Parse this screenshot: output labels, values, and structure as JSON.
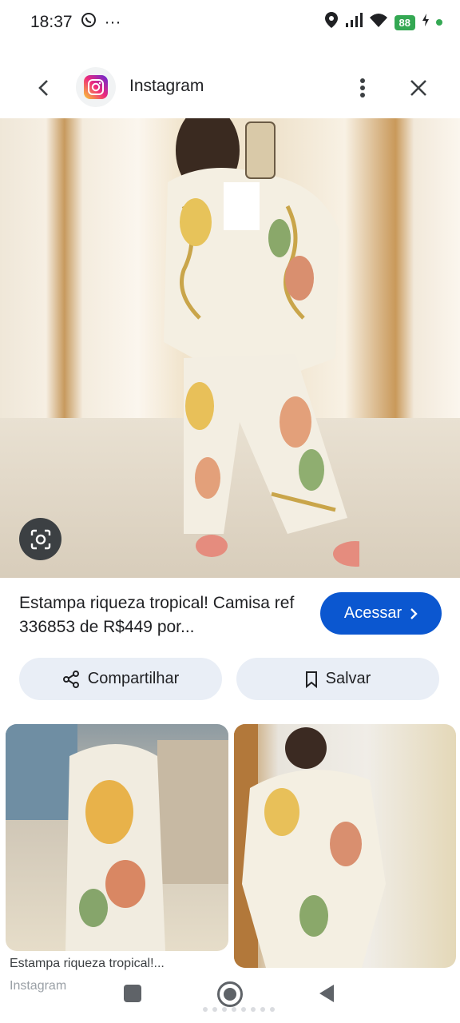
{
  "status_bar": {
    "time": "18:37",
    "extra": "···",
    "battery": "88"
  },
  "header": {
    "title": "Instagram",
    "back_icon": "arrow-back-icon",
    "app_icon": "instagram-logo-icon",
    "more_icon": "more-vert-icon",
    "close_icon": "close-icon"
  },
  "result": {
    "caption": "Estampa riqueza tropical! Camisa ref 336853 de R$449 por...",
    "cta_label": "Acessar",
    "cta_icon": "chevron-right-icon"
  },
  "actions": {
    "share_label": "Compartilhar",
    "save_label": "Salvar"
  },
  "related": [
    {
      "title": "Estampa riqueza tropical!...",
      "source": "Instagram"
    },
    {
      "title": "",
      "source": ""
    }
  ],
  "colors": {
    "accent": "#0b57d0",
    "chip_bg": "#e9eef6",
    "battery": "#34a853"
  }
}
